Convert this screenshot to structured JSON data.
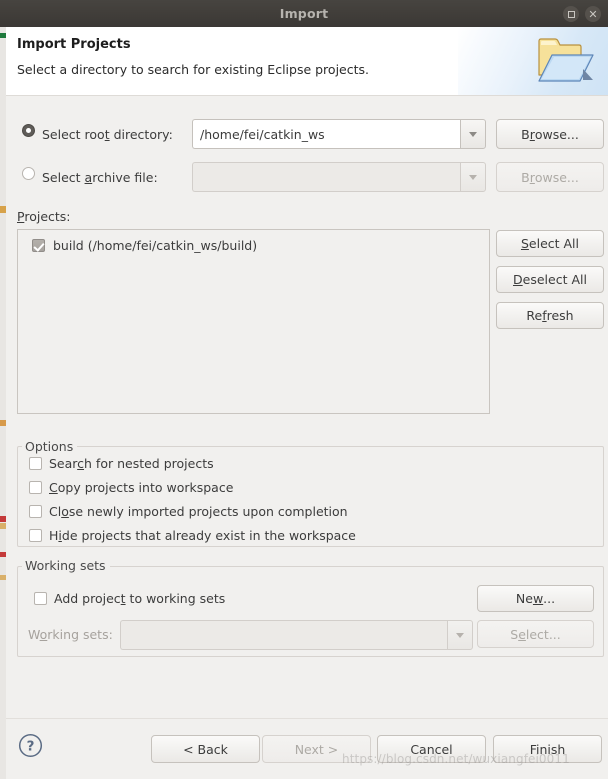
{
  "window": {
    "title": "Import",
    "maximize_icon": "maximize-icon",
    "close_icon": "close-icon"
  },
  "header": {
    "title": "Import Projects",
    "subtitle": "Select a directory to search for existing Eclipse projects.",
    "icon": "open-folder-icon"
  },
  "source": {
    "root_directory": {
      "label_before": "Select roo",
      "label_mnemonic": "t",
      "label_after": " directory:",
      "full_label": "Select root directory:",
      "selected": true,
      "value": "/home/fei/catkin_ws",
      "placeholder": "",
      "browse_label_before": "B",
      "browse_mnemonic": "r",
      "browse_label_after": "owse...",
      "browse_full": "Browse...",
      "browse_enabled": true
    },
    "archive_file": {
      "label_before": "Select ",
      "label_mnemonic": "a",
      "label_after": "rchive file:",
      "full_label": "Select archive file:",
      "selected": false,
      "value": "",
      "placeholder": "",
      "browse_label_before": "B",
      "browse_mnemonic": "r",
      "browse_label_after": "owse...",
      "browse_full": "Browse...",
      "browse_enabled": false
    }
  },
  "projects": {
    "label_before": "",
    "label_mnemonic": "P",
    "label_after": "rojects:",
    "full_label": "Projects:",
    "items": [
      {
        "label": "build (/home/fei/catkin_ws/build)",
        "checked": true
      }
    ],
    "buttons": [
      {
        "before": "",
        "mnemonic": "S",
        "after": "elect All",
        "full": "Select All",
        "enabled": true
      },
      {
        "before": "",
        "mnemonic": "D",
        "after": "eselect All",
        "full": "Deselect All",
        "enabled": true
      },
      {
        "before": "Re",
        "mnemonic": "f",
        "after": "resh",
        "full": "Refresh",
        "enabled": true
      }
    ]
  },
  "options": {
    "legend": "Options",
    "items": [
      {
        "before": "Sear",
        "mnemonic": "c",
        "after": "h for nested projects",
        "full": "Search for nested projects",
        "checked": false
      },
      {
        "before": "",
        "mnemonic": "C",
        "after": "opy projects into workspace",
        "full": "Copy projects into workspace",
        "checked": false
      },
      {
        "before": "Cl",
        "mnemonic": "o",
        "after": "se newly imported projects upon completion",
        "full": "Close newly imported projects upon completion",
        "checked": false
      },
      {
        "before": "H",
        "mnemonic": "i",
        "after": "de projects that already exist in the workspace",
        "full": "Hide projects that already exist in the workspace",
        "checked": false
      }
    ]
  },
  "working_sets": {
    "legend": "Working sets",
    "add_checkbox": {
      "before": "Add projec",
      "mnemonic": "t",
      "after": " to working sets",
      "full": "Add project to working sets",
      "checked": false
    },
    "new_button": {
      "before": "Ne",
      "mnemonic": "w",
      "after": "...",
      "full": "New...",
      "enabled": true
    },
    "combo_label": {
      "before": "W",
      "mnemonic": "o",
      "after": "rking sets:",
      "full": "Working sets:",
      "enabled": false
    },
    "combo_value": "",
    "select_button": {
      "before": "S",
      "mnemonic": "e",
      "after": "lect...",
      "full": "Select...",
      "enabled": false
    }
  },
  "footer": {
    "help_icon": "help-icon",
    "buttons": [
      {
        "label": "< Back",
        "enabled": true
      },
      {
        "label": "Next >",
        "enabled": false
      },
      {
        "label": "Cancel",
        "enabled": true
      },
      {
        "label": "Finish",
        "enabled": true
      }
    ]
  },
  "watermark": "https://blog.csdn.net/wuxiangfei0011"
}
